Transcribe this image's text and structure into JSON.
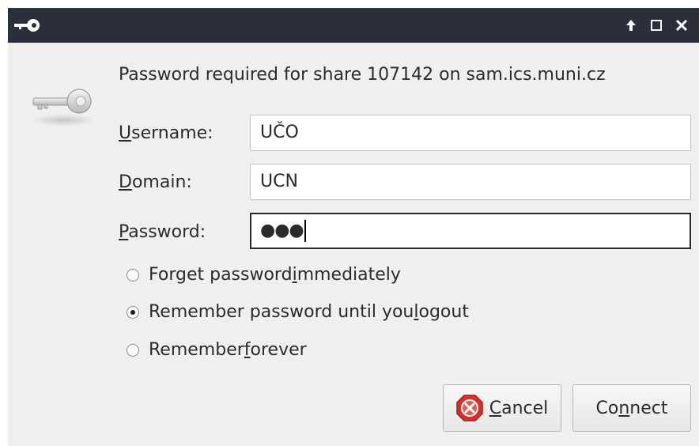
{
  "dialog": {
    "prompt": "Password required for share 107142 on sam.ics.muni.cz"
  },
  "fields": {
    "username": {
      "label_mnemonic": "U",
      "label_rest": "sername:",
      "value": "UČO"
    },
    "domain": {
      "label_mnemonic": "D",
      "label_rest": "omain:",
      "value": "UCN"
    },
    "password": {
      "label_mnemonic": "P",
      "label_rest": "assword:",
      "value": "●●●"
    }
  },
  "options": [
    {
      "pre": "Forget password ",
      "mnemonic": "i",
      "post": "mmediately",
      "selected": false
    },
    {
      "pre": "Remember password until you ",
      "mnemonic": "l",
      "post": "ogout",
      "selected": true
    },
    {
      "pre": "Remember ",
      "mnemonic": "f",
      "post": "orever",
      "selected": false
    }
  ],
  "buttons": {
    "cancel": {
      "mnemonic": "C",
      "rest": "ancel"
    },
    "connect": {
      "pre": "Co",
      "mnemonic": "n",
      "post": "nect"
    }
  },
  "icons": {
    "titlebar": "key-icon",
    "dialog": "key-icon",
    "window_controls": [
      "arrow-up-icon",
      "maximize-icon",
      "close-icon"
    ],
    "cancel": "cancel-stop-icon"
  },
  "colors": {
    "titlebar": "#2a2f3b",
    "dialog_bg": "#f0efee",
    "cancel_icon": "#d9302c"
  }
}
